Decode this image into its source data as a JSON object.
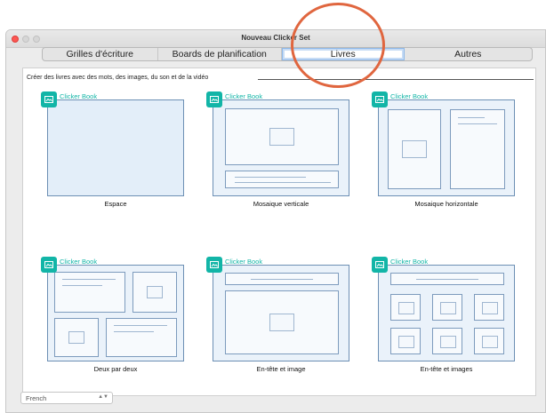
{
  "window": {
    "title": "Nouveau Clicker Set"
  },
  "tabs": [
    {
      "label": "Grilles d'écriture",
      "active": false
    },
    {
      "label": "Boards de planification",
      "active": false
    },
    {
      "label": "Livres",
      "active": true
    },
    {
      "label": "Autres",
      "active": false
    }
  ],
  "panel": {
    "description": "Créer des livres avec des mots, des images, du son et de la vidéo",
    "brand_label": "Clicker Book",
    "templates": [
      {
        "label": "Espace"
      },
      {
        "label": "Mosaique verticale"
      },
      {
        "label": "Mosaique horizontale"
      },
      {
        "label": "Deux par deux"
      },
      {
        "label": "En-tête et image"
      },
      {
        "label": "En-tête et images"
      }
    ]
  },
  "language_select": {
    "value": "French"
  },
  "colors": {
    "accent": "#12b5a7",
    "highlight": "#e0663f",
    "frame": "#6c8fb4"
  }
}
